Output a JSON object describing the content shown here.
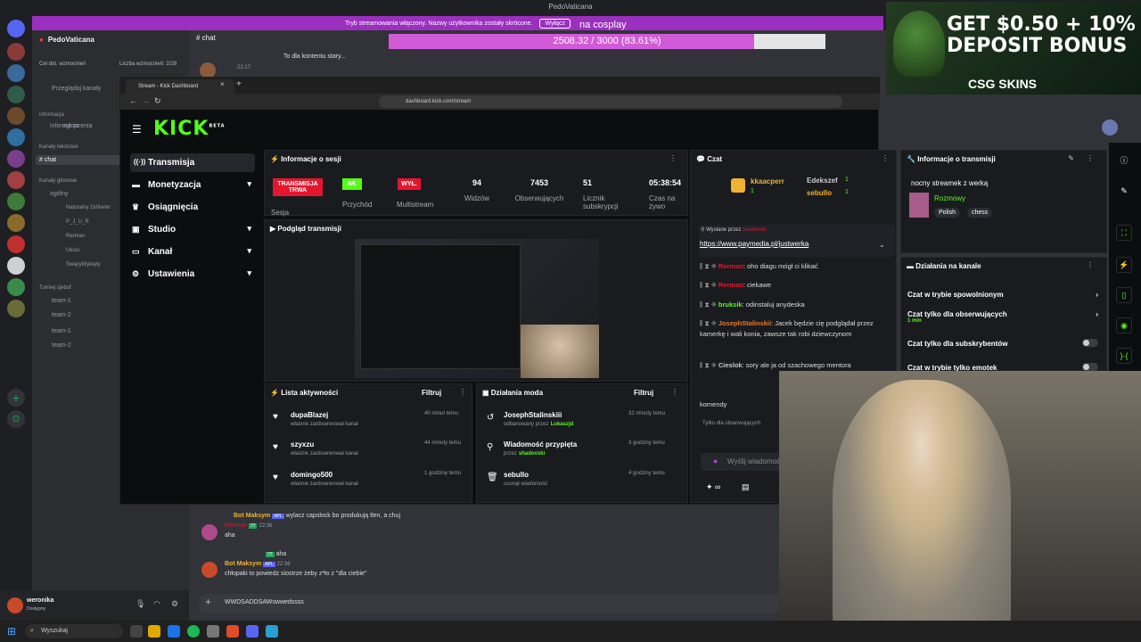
{
  "os": {
    "window_title": "PedoVaticana"
  },
  "discord": {
    "banner_text": "Tryb streamowania włączony. Nazwy użytkownika zostały skrócone.",
    "banner_button": "Wyłącz",
    "server_name": "PedoVaticana",
    "boost_goal": "Cel dot. wzmocnień",
    "boost_count": "Liczba wzmocnień: 2/28",
    "browse_channels": "Przeglądaj kanały",
    "cat_info": "informacja",
    "chan_announcements": "ogłoszenia",
    "cat_text": "Kanały tekstowe",
    "chan_chat": "chat",
    "cat_voice": "Kanały głosowe",
    "chan_general": "ogólny",
    "voice_users": [
      "Naturalny Gofrerer",
      "P_J_U_R",
      "Rerman",
      "Ukclu",
      "ŚwiętyWyklęty"
    ],
    "cat_tournament": "Turniej cjebuf",
    "teams": [
      "team-1",
      "team-2",
      "team-1",
      "team-2"
    ],
    "current_channel": "chat",
    "top_msg_text": "To dla kontentu stary...",
    "top_msg_time": "22:17",
    "messages": [
      {
        "name": "Bot Maksym",
        "tag": "APL",
        "time": "",
        "text": "wylacz capslock bo produkują tlen, a chuj"
      },
      {
        "name": "Rerman",
        "tag": "77",
        "time": "22:36",
        "text": "aha"
      },
      {
        "name": "",
        "tag": "77",
        "time": "",
        "text": "aha"
      },
      {
        "name": "Bot Maksym",
        "tag": "APL",
        "time": "22:36",
        "text": "chłopaki to powiedz siostrze żeby z*ło z \"dla ciebie\""
      }
    ],
    "input_value": "WWDSADDSAWswwedssss",
    "user_name": "weronika",
    "user_status": "Dostępny",
    "taskbar_search": "Wyszukaj"
  },
  "progress": {
    "caption": "na cosplay",
    "label": "2508.32 / 3000 (83.61%)",
    "fraction": 0.8361
  },
  "ad": {
    "line1": "GET $0.50 + 10%",
    "line2": "DEPOSIT BONUS",
    "brand": "CSG SKINS"
  },
  "browser": {
    "tab_title": "Stream - Kick Dashboard",
    "url": "dashboard.kick.com/stream"
  },
  "kick": {
    "logo": "KICK",
    "logo_sup": "BETA",
    "nav": [
      {
        "label": "Transmisja"
      },
      {
        "label": "Monetyzacja"
      },
      {
        "label": "Osiągnięcia"
      },
      {
        "label": "Studio"
      },
      {
        "label": "Kanał"
      },
      {
        "label": "Ustawienia"
      }
    ],
    "session_title": "Informacje o sesji",
    "live_badge": "TRANSMISJA TRWA",
    "session_sub": "Sesja",
    "on_badge": "Wł.",
    "income": "Przychód",
    "off_badge": "WYŁ.",
    "multistream": "Multistream",
    "viewers_value": "94",
    "viewers_label": "Widzów",
    "followers_value": "7453",
    "followers_label": "Obserwujących",
    "subs_value": "51",
    "subs_label": "Licznik subskrypcji",
    "time_value": "05:38:54",
    "time_label": "Czas na żywo",
    "preview_title": "Podgląd transmisji",
    "activity_title": "Lista aktywności",
    "filter": "Filtruj",
    "activity": [
      {
        "user": "dupaBlazej",
        "action": "właśnie zaobserwował kanał",
        "time": "40 minut temu"
      },
      {
        "user": "szyxzu",
        "action": "właśnie zaobserwował kanał",
        "time": "44 minuty temu"
      },
      {
        "user": "domingo500",
        "action": "właśnie zaobserwował kanał",
        "time": "1 godzinę temu"
      }
    ],
    "mod_title": "Działania moda",
    "mod": [
      {
        "user": "JosephStalinskiii",
        "action": "odbanowany przez",
        "by": "Lukaszjd",
        "time": "32 minuty temu"
      },
      {
        "user": "Wiadomość przypięta",
        "action": "przez",
        "by": "shadovski",
        "time": "3 godziny temu"
      },
      {
        "user": "sebullo",
        "action": "usunął wiadomość",
        "by": "",
        "time": "4 godziny temu"
      }
    ],
    "chat_title": "Czat",
    "top_gifters": [
      "kkaacperr",
      "Edekszef",
      "sebullo"
    ],
    "top_gifter_counts": [
      "1",
      "1",
      "1"
    ],
    "pinned_label": "Wysłane przez",
    "pinned_by": "shadovski",
    "pinned_link": "https://www.paymedia.pl/justwerka",
    "chat": [
      {
        "user": "Rerman",
        "text": "oho diagu mógł ci klikać"
      },
      {
        "user": "Rerman",
        "text": "ciekawe"
      },
      {
        "user": "bruksik",
        "text": "odinstaluj anydeska"
      },
      {
        "user": "JosephStalinskii",
        "text": "Jacek będzie cię podglądał przez kamerkę i wali konia, zawsze tak robi dziewczynom"
      },
      {
        "user": "Cieslok",
        "text": "sory ale ja od szachowego mentora"
      },
      {
        "user": "",
        "text": "komendy"
      }
    ],
    "followers_only_hint": "Tylko dla obserwujących",
    "chat_placeholder": "Wyślij wiadomość",
    "stream_info_title": "Informacje o transmisji",
    "stream_title": "nocny streamek z werką",
    "stream_category": "Rozmowy",
    "stream_tags": [
      "Polish",
      "chess"
    ],
    "channel_actions_title": "Działania na kanale",
    "channel_actions": [
      {
        "label": "Czat w trybie spowolnionym",
        "sub": ""
      },
      {
        "label": "Czat tylko dla obserwujących",
        "sub": "1 min"
      },
      {
        "label": "Czat tylko dla subskrybentów",
        "sub": ""
      },
      {
        "label": "Czat w trybie tylko emotek",
        "sub": ""
      }
    ]
  },
  "colors": {
    "kick_green": "#53fc18",
    "live_red": "#e4162e",
    "discord_bg": "#313338",
    "progress_fill": "#d15ad6"
  }
}
